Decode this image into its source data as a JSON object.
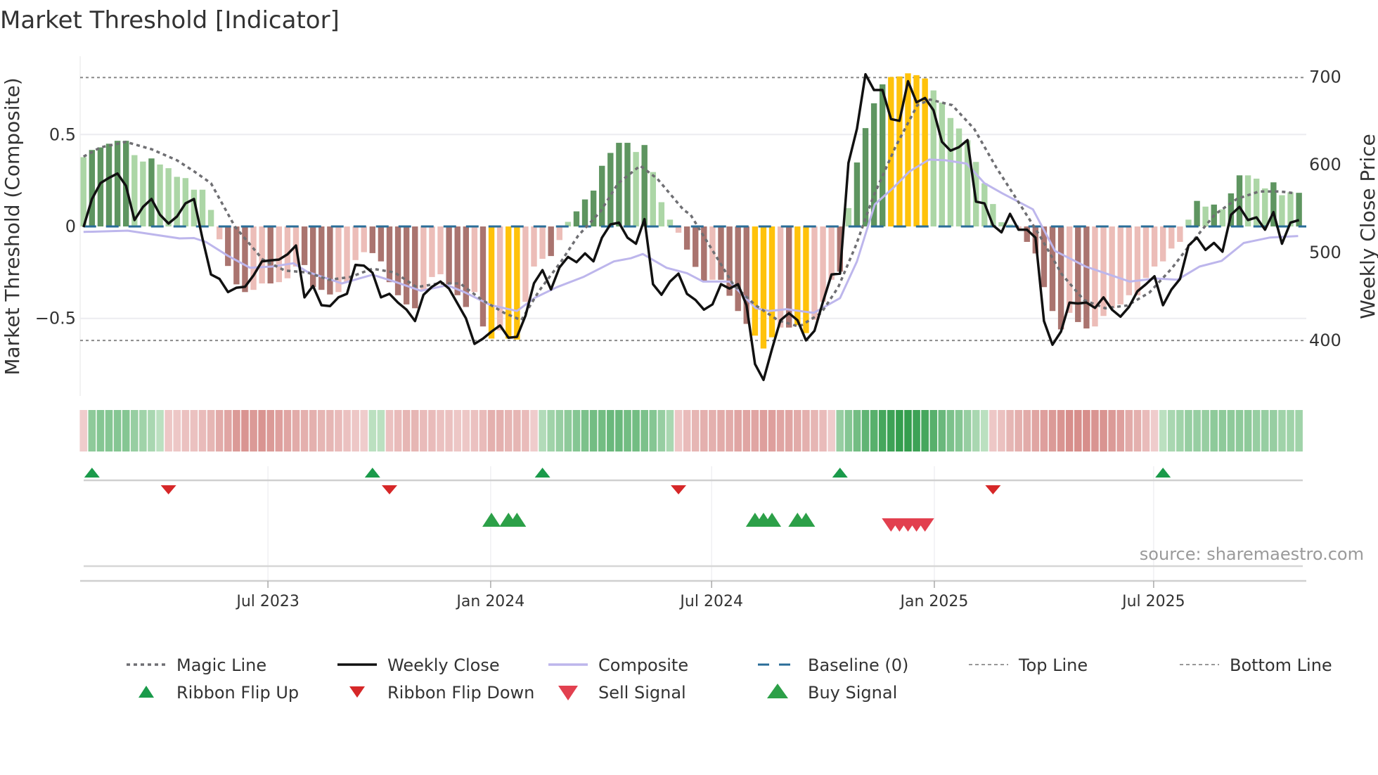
{
  "chart_data": {
    "type": "bar",
    "title": "Market Threshold [Indicator]",
    "ylabel": "Market Threshold (Composite)",
    "ylabel_right": "Weekly Close Price",
    "ylim": [
      -0.85,
      0.92
    ],
    "y_ticks": [
      {
        "v": 0.5,
        "label": "0.5"
      },
      {
        "v": 0,
        "label": "0"
      },
      {
        "v": -0.5,
        "label": "−0.5"
      }
    ],
    "y2_ticks": [
      {
        "v": 700,
        "label": "700"
      },
      {
        "v": 600,
        "label": "600"
      },
      {
        "v": 500,
        "label": "500"
      },
      {
        "v": 400,
        "label": "400"
      }
    ],
    "x_ticks": [
      {
        "week": 22.7,
        "label": "Jul 2023"
      },
      {
        "week": 48.9,
        "label": "Jan 2024"
      },
      {
        "week": 74.9,
        "label": "Jul 2024"
      },
      {
        "week": 101.1,
        "label": "Jan 2025"
      },
      {
        "week": 126.9,
        "label": "Jul 2025"
      }
    ],
    "top_line": 0.81,
    "bottom_line": -0.62,
    "baseline": 0,
    "colors": {
      "dg": "#5e9560",
      "lg": "#acd6a6",
      "dr": "#aa746f",
      "lr": "#ecbdb8",
      "y": "#ffc20a",
      "magic": "#6f6f73",
      "close": "#111111",
      "composite": "#bdb6ec",
      "baseline": "#2a6d98",
      "flip_up": "#1a9a4a",
      "flip_down": "#d62728",
      "buy": "#2ca048",
      "sell": "#e2404f"
    },
    "bars": [
      0.377,
      0.416,
      0.43,
      0.45,
      0.466,
      0.466,
      0.388,
      0.353,
      0.37,
      0.337,
      0.317,
      0.27,
      0.263,
      0.2,
      0.2,
      0.09,
      -0.07,
      -0.215,
      -0.315,
      -0.357,
      -0.345,
      -0.31,
      -0.31,
      -0.303,
      -0.282,
      -0.218,
      -0.21,
      -0.33,
      -0.345,
      -0.37,
      -0.357,
      -0.303,
      -0.183,
      -0.14,
      -0.145,
      -0.19,
      -0.303,
      -0.374,
      -0.424,
      -0.445,
      -0.345,
      -0.275,
      -0.26,
      -0.315,
      -0.374,
      -0.438,
      -0.357,
      -0.544,
      -0.61,
      -0.565,
      -0.61,
      -0.615,
      -0.41,
      -0.218,
      -0.176,
      -0.161,
      -0.074,
      0.025,
      0.082,
      0.147,
      0.195,
      0.33,
      0.4,
      0.455,
      0.455,
      0.405,
      0.443,
      0.296,
      0.132,
      0.037,
      -0.034,
      -0.126,
      -0.22,
      -0.3,
      -0.29,
      -0.29,
      -0.377,
      -0.46,
      -0.53,
      -0.594,
      -0.664,
      -0.603,
      -0.55,
      -0.55,
      -0.537,
      -0.58,
      -0.508,
      -0.41,
      -0.29,
      -0.246,
      0.1,
      0.348,
      0.535,
      0.67,
      0.773,
      0.813,
      0.816,
      0.833,
      0.823,
      0.805,
      0.74,
      0.674,
      0.59,
      0.533,
      0.469,
      0.351,
      0.235,
      0.122,
      0.023,
      0.01,
      -0.01,
      -0.084,
      -0.147,
      -0.33,
      -0.46,
      -0.56,
      -0.47,
      -0.52,
      -0.555,
      -0.544,
      -0.487,
      -0.445,
      -0.424,
      -0.374,
      -0.374,
      -0.28,
      -0.218,
      -0.19,
      -0.12,
      -0.084,
      0.037,
      0.139,
      0.108,
      0.119,
      0.093,
      0.18,
      0.278,
      0.278,
      0.26,
      0.207,
      0.24,
      0.17,
      0.186,
      0.183
    ],
    "bar_colors": [
      "lg",
      "dg",
      "dg",
      "dg",
      "dg",
      "dg",
      "lg",
      "lg",
      "dg",
      "lg",
      "lg",
      "lg",
      "lg",
      "lg",
      "lg",
      "lg",
      "lr",
      "dr",
      "dr",
      "dr",
      "lr",
      "lr",
      "dr",
      "lr",
      "lr",
      "lr",
      "dr",
      "dr",
      "dr",
      "dr",
      "lr",
      "lr",
      "lr",
      "lr",
      "dr",
      "dr",
      "dr",
      "dr",
      "dr",
      "dr",
      "lr",
      "lr",
      "lr",
      "dr",
      "dr",
      "dr",
      "lr",
      "dr",
      "y",
      "lr",
      "y",
      "y",
      "lr",
      "lr",
      "lr",
      "dr",
      "lr",
      "lg",
      "dg",
      "dg",
      "dg",
      "dg",
      "dg",
      "dg",
      "dg",
      "lg",
      "dg",
      "lg",
      "lg",
      "lg",
      "lr",
      "dr",
      "dr",
      "dr",
      "lr",
      "dr",
      "dr",
      "dr",
      "dr",
      "y",
      "y",
      "y",
      "lr",
      "dr",
      "y",
      "y",
      "lr",
      "lr",
      "lr",
      "dr",
      "lg",
      "dg",
      "dg",
      "dg",
      "dg",
      "y",
      "y",
      "y",
      "y",
      "y",
      "lg",
      "lg",
      "lg",
      "lg",
      "lg",
      "lg",
      "lg",
      "lg",
      "lg",
      "lg",
      "lr",
      "dr",
      "dr",
      "dr",
      "dr",
      "dr",
      "lr",
      "dr",
      "dr",
      "lr",
      "lr",
      "lr",
      "lr",
      "lr",
      "lr",
      "lr",
      "lr",
      "lr",
      "lr",
      "lr",
      "lg",
      "dg",
      "lg",
      "dg",
      "lg",
      "dg",
      "dg",
      "lg",
      "lg",
      "lg",
      "dg",
      "lg",
      "lg",
      "dg"
    ],
    "weekly_close": [
      529,
      561,
      579,
      585,
      590,
      576,
      537,
      552,
      561,
      543,
      533,
      541,
      556,
      561,
      516,
      475,
      470,
      455,
      460,
      461,
      474,
      490,
      491,
      492,
      498,
      508,
      449,
      462,
      440,
      439,
      449,
      453,
      486,
      485,
      477,
      449,
      453,
      443,
      435,
      422,
      452,
      461,
      467,
      459,
      442,
      425,
      396,
      402,
      410,
      417,
      403,
      404,
      428,
      465,
      480,
      458,
      483,
      495,
      489,
      499,
      490,
      517,
      532,
      534,
      517,
      510,
      538,
      464,
      452,
      467,
      476,
      453,
      446,
      435,
      441,
      464,
      459,
      464,
      440,
      373,
      355,
      390,
      423,
      431,
      423,
      400,
      411,
      444,
      475,
      476,
      602,
      641,
      703,
      685,
      685,
      652,
      650,
      695,
      671,
      676,
      662,
      626,
      616,
      620,
      628,
      558,
      556,
      531,
      523,
      544,
      526,
      526,
      517,
      422,
      395,
      410,
      443,
      442,
      443,
      437,
      449,
      435,
      427,
      438,
      456,
      464,
      473,
      440,
      458,
      470,
      508,
      517,
      503,
      511,
      501,
      543,
      552,
      537,
      540,
      526,
      546,
      510,
      534,
      537
    ],
    "magic_line": [
      [
        1,
        0.38
      ],
      [
        3,
        0.43
      ],
      [
        6,
        0.46
      ],
      [
        9,
        0.42
      ],
      [
        12,
        0.36
      ],
      [
        14,
        0.3
      ],
      [
        16,
        0.235
      ],
      [
        18.8,
        0
      ],
      [
        22.1,
        -0.18
      ],
      [
        24.7,
        -0.24
      ],
      [
        27.3,
        -0.25
      ],
      [
        29.9,
        -0.29
      ],
      [
        32.4,
        -0.275
      ],
      [
        35,
        -0.23
      ],
      [
        37.6,
        -0.25
      ],
      [
        40.2,
        -0.33
      ],
      [
        42.8,
        -0.31
      ],
      [
        45.3,
        -0.31
      ],
      [
        47.9,
        -0.4
      ],
      [
        50.5,
        -0.47
      ],
      [
        52.5,
        -0.51
      ],
      [
        54.6,
        -0.35
      ],
      [
        57.2,
        -0.19
      ],
      [
        59.2,
        -0.05
      ],
      [
        61.8,
        0.08
      ],
      [
        63.9,
        0.235
      ],
      [
        66.5,
        0.33
      ],
      [
        68.5,
        0.26
      ],
      [
        71.6,
        0.09
      ],
      [
        72.4,
        0.065
      ],
      [
        75,
        -0.13
      ],
      [
        77.5,
        -0.32
      ],
      [
        80.1,
        -0.43
      ],
      [
        82.7,
        -0.51
      ],
      [
        85.2,
        -0.545
      ],
      [
        87.8,
        -0.47
      ],
      [
        89.8,
        -0.33
      ],
      [
        91.9,
        -0.1
      ],
      [
        93.9,
        0.16
      ],
      [
        96.5,
        0.43
      ],
      [
        99.1,
        0.66
      ],
      [
        100.6,
        0.69
      ],
      [
        103.2,
        0.66
      ],
      [
        105.8,
        0.53
      ],
      [
        108.4,
        0.32
      ],
      [
        110.9,
        0.14
      ],
      [
        113.5,
        -0.05
      ],
      [
        116.1,
        -0.26
      ],
      [
        118.7,
        -0.4
      ],
      [
        121.2,
        -0.445
      ],
      [
        123.8,
        -0.43
      ],
      [
        126.4,
        -0.36
      ],
      [
        129,
        -0.23
      ],
      [
        131.5,
        -0.08
      ],
      [
        134.1,
        0.065
      ],
      [
        136.7,
        0.15
      ],
      [
        139.3,
        0.19
      ],
      [
        141.8,
        0.19
      ],
      [
        143.6,
        0.18
      ]
    ],
    "composite_line": [
      [
        1,
        -0.03
      ],
      [
        6.2,
        -0.023
      ],
      [
        12.3,
        -0.065
      ],
      [
        14,
        -0.063
      ],
      [
        15.4,
        -0.084
      ],
      [
        18,
        -0.16
      ],
      [
        20.6,
        -0.225
      ],
      [
        23.2,
        -0.218
      ],
      [
        25.7,
        -0.2
      ],
      [
        27.3,
        -0.246
      ],
      [
        31.4,
        -0.31
      ],
      [
        35,
        -0.263
      ],
      [
        37.6,
        -0.3
      ],
      [
        40.7,
        -0.35
      ],
      [
        43.8,
        -0.32
      ],
      [
        45.8,
        -0.357
      ],
      [
        48.9,
        -0.428
      ],
      [
        52,
        -0.46
      ],
      [
        54.1,
        -0.388
      ],
      [
        56.7,
        -0.33
      ],
      [
        59.8,
        -0.275
      ],
      [
        63.4,
        -0.19
      ],
      [
        65.4,
        -0.173
      ],
      [
        66.8,
        -0.15
      ],
      [
        69.6,
        -0.225
      ],
      [
        72,
        -0.254
      ],
      [
        73.9,
        -0.3
      ],
      [
        77,
        -0.3
      ],
      [
        80.1,
        -0.445
      ],
      [
        81.7,
        -0.46
      ],
      [
        83.7,
        -0.45
      ],
      [
        86.9,
        -0.47
      ],
      [
        90,
        -0.39
      ],
      [
        92,
        -0.19
      ],
      [
        94.1,
        0.12
      ],
      [
        96.2,
        0.207
      ],
      [
        98.2,
        0.3
      ],
      [
        100.5,
        0.364
      ],
      [
        102.4,
        0.36
      ],
      [
        104.9,
        0.342
      ],
      [
        107,
        0.235
      ],
      [
        109.1,
        0.18
      ],
      [
        112.7,
        0.093
      ],
      [
        115.3,
        -0.133
      ],
      [
        118.9,
        -0.218
      ],
      [
        124.1,
        -0.3
      ],
      [
        127.2,
        -0.283
      ],
      [
        129.7,
        -0.29
      ],
      [
        132.3,
        -0.218
      ],
      [
        134.9,
        -0.187
      ],
      [
        137.5,
        -0.09
      ],
      [
        140.6,
        -0.06
      ],
      [
        143.9,
        -0.052
      ]
    ],
    "ribbon": [
      -0.15,
      0.4,
      0.45,
      0.45,
      0.45,
      0.45,
      0.35,
      0.3,
      0.25,
      0.15,
      -0.2,
      -0.2,
      -0.25,
      -0.25,
      -0.3,
      -0.35,
      -0.45,
      -0.5,
      -0.6,
      -0.65,
      -0.6,
      -0.65,
      -0.6,
      -0.55,
      -0.5,
      -0.45,
      -0.4,
      -0.4,
      -0.35,
      -0.35,
      -0.3,
      -0.25,
      -0.2,
      -0.15,
      0.15,
      0.15,
      -0.25,
      -0.3,
      -0.35,
      -0.35,
      -0.3,
      -0.3,
      -0.25,
      -0.25,
      -0.2,
      -0.2,
      -0.25,
      -0.3,
      -0.4,
      -0.4,
      -0.35,
      -0.35,
      -0.3,
      -0.15,
      0.2,
      0.3,
      0.35,
      0.4,
      0.45,
      0.5,
      0.55,
      0.55,
      0.6,
      0.6,
      0.55,
      0.55,
      0.5,
      0.45,
      0.35,
      0.25,
      -0.2,
      -0.3,
      -0.35,
      -0.4,
      -0.4,
      -0.45,
      -0.45,
      -0.5,
      -0.5,
      -0.5,
      -0.55,
      -0.55,
      -0.5,
      -0.5,
      -0.45,
      -0.4,
      -0.35,
      -0.3,
      -0.15,
      0.35,
      0.45,
      0.55,
      0.65,
      0.7,
      0.8,
      0.85,
      0.9,
      0.9,
      0.85,
      0.8,
      0.7,
      0.6,
      0.5,
      0.45,
      0.35,
      0.25,
      0.15,
      -0.2,
      -0.25,
      -0.35,
      -0.4,
      -0.45,
      -0.5,
      -0.55,
      -0.6,
      -0.65,
      -0.7,
      -0.7,
      -0.7,
      -0.65,
      -0.65,
      -0.6,
      -0.55,
      -0.45,
      -0.4,
      -0.3,
      -0.15,
      0.15,
      0.25,
      0.3,
      0.35,
      0.35,
      0.35,
      0.4,
      0.4,
      0.4,
      0.4,
      0.4,
      0.35,
      0.35,
      0.35,
      0.3,
      0.3,
      0.3
    ],
    "ribbon_flip_up_weeks": [
      2,
      35,
      55,
      90,
      128
    ],
    "ribbon_flip_down_weeks": [
      11,
      37,
      71,
      108
    ],
    "buy_signal_weeks": [
      49,
      51,
      52,
      80,
      81,
      82,
      85,
      86
    ],
    "sell_signal_weeks": [
      96,
      97,
      98,
      99,
      100
    ],
    "legend_position": "bottom",
    "legend": [
      {
        "key": "magic",
        "label": "Magic Line"
      },
      {
        "key": "close",
        "label": "Weekly Close"
      },
      {
        "key": "composite",
        "label": "Composite"
      },
      {
        "key": "baseline",
        "label": "Baseline (0)"
      },
      {
        "key": "top",
        "label": "Top Line"
      },
      {
        "key": "bottom",
        "label": "Bottom Line"
      },
      {
        "key": "flip_up",
        "label": "Ribbon Flip Up"
      },
      {
        "key": "flip_down",
        "label": "Ribbon Flip Down"
      },
      {
        "key": "sell",
        "label": "Sell Signal"
      },
      {
        "key": "buy",
        "label": "Buy Signal"
      }
    ],
    "source": "source: sharemaestro.com"
  }
}
